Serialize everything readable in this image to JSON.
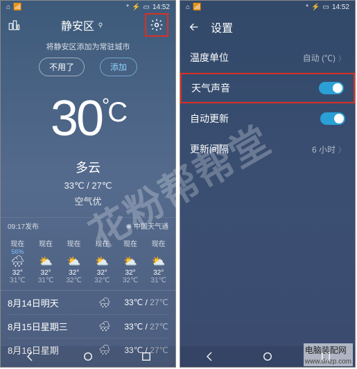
{
  "statusbar": {
    "bt": "⋮",
    "wifi": "📶",
    "batt": "▭",
    "battplug": "⚡",
    "time": "14:52",
    "bticon": "*"
  },
  "left": {
    "location": "静安区",
    "hint": "将静安区添加为常驻城市",
    "btn_dismiss": "不用了",
    "btn_add": "添加",
    "temperature": "30",
    "deg": "°",
    "unit": "C",
    "condition": "多云",
    "high_low": "33℃ / 27℃",
    "aqi": "空气优",
    "published": "09:17发布",
    "source_icon": "❋",
    "source": "中国天气通",
    "hourly": [
      {
        "label": "现在",
        "prob": "56%",
        "icon": "🌧",
        "hi": "32°",
        "lo": "31℃"
      },
      {
        "label": "现在",
        "prob": "",
        "icon": "⛅",
        "hi": "32°",
        "lo": "31℃"
      },
      {
        "label": "现在",
        "prob": "",
        "icon": "⛅",
        "hi": "32°",
        "lo": "32℃"
      },
      {
        "label": "现在",
        "prob": "",
        "icon": "⛅",
        "hi": "32°",
        "lo": "32℃"
      },
      {
        "label": "现在",
        "prob": "",
        "icon": "⛅",
        "hi": "32°",
        "lo": "32℃"
      },
      {
        "label": "现在",
        "prob": "",
        "icon": "⛅",
        "hi": "32°",
        "lo": "31℃"
      }
    ],
    "daily": [
      {
        "name": "8月14日明天",
        "icon": "🌧",
        "hi": "33℃",
        "lo": "27℃"
      },
      {
        "name": "8月15日星期三",
        "icon": "🌧",
        "hi": "33℃",
        "lo": "27℃"
      },
      {
        "name": "8月16日星期",
        "icon": "🌧",
        "hi": "33℃",
        "lo": "27℃"
      }
    ]
  },
  "right": {
    "title": "设置",
    "rows": {
      "temp_unit": {
        "label": "温度单位",
        "value": "自动 (℃)"
      },
      "sound": {
        "label": "天气声音"
      },
      "auto": {
        "label": "自动更新"
      },
      "interval": {
        "label": "更新间隔",
        "value": "6 小时"
      }
    }
  },
  "watermark": "花粉帮帮堂",
  "footer": {
    "title": "电脑装配网",
    "url": "www.dnzp.com"
  }
}
